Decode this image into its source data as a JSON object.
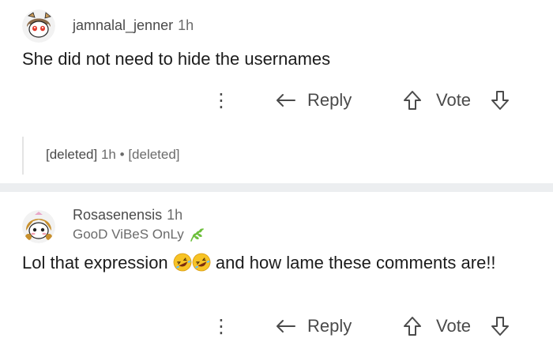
{
  "comments": [
    {
      "username": "jamnalal_jenner",
      "time": "1h",
      "body": "She did not need to hide the usernames",
      "actions": {
        "more": "⋮",
        "reply": "Reply",
        "vote": "Vote"
      }
    },
    {
      "username": "Rosasenensis",
      "time": "1h",
      "flair": "GooD ViBeS OnLy",
      "body_before": "Lol that expression",
      "body_after": "and how lame these comments are!!",
      "emojis": [
        "rofl-emoji",
        "rofl-emoji"
      ],
      "actions": {
        "more": "⋮",
        "reply": "Reply",
        "vote": "Vote"
      }
    }
  ],
  "deleted": {
    "user": "[deleted]",
    "time": "1h",
    "separator": "•",
    "body": "[deleted]"
  },
  "colors": {
    "text": "#1c1c1c",
    "muted": "#6b6b6b",
    "divider": "#eceef0",
    "thread_line": "#e4e4e4",
    "leaf": "#6cbf3a"
  }
}
